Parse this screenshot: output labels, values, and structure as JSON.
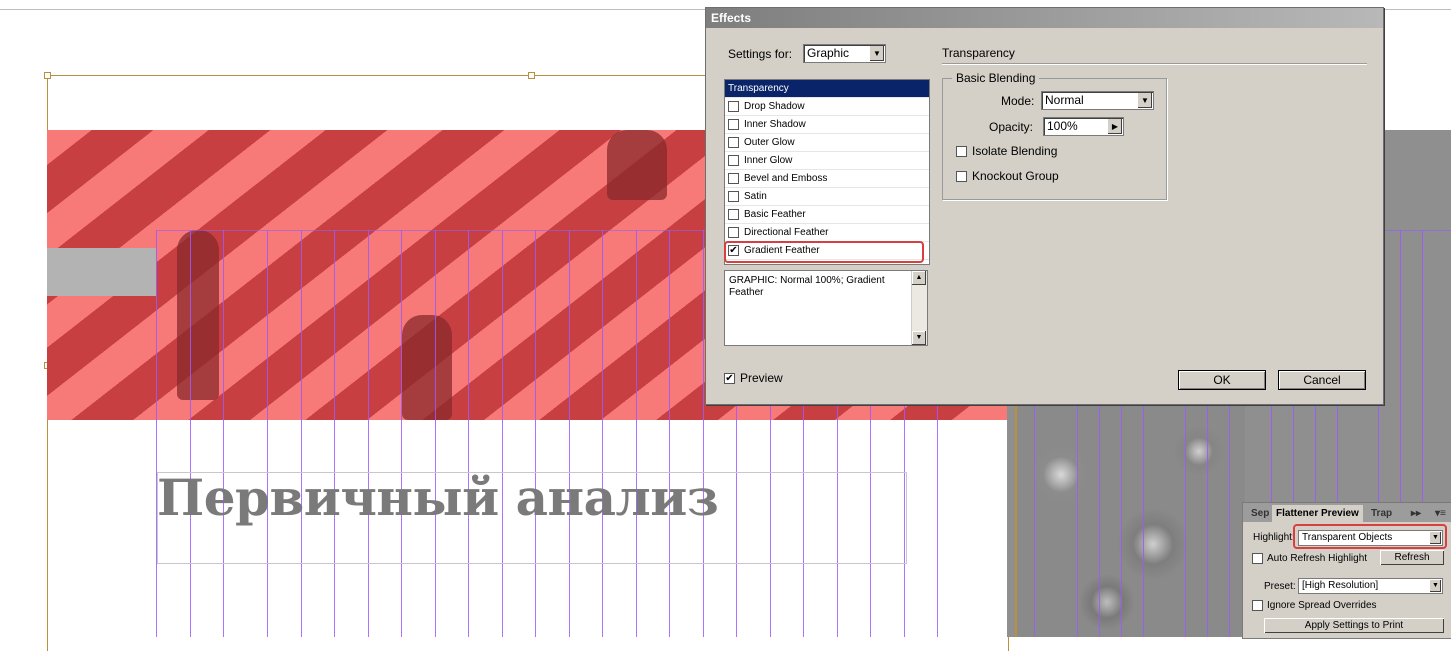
{
  "canvas": {
    "heading": "Первичный анализ"
  },
  "effects_dialog": {
    "title": "Effects",
    "settings_for_label": "Settings for:",
    "settings_for_value": "Graphic",
    "effects": [
      {
        "label": "Transparency",
        "checked": false,
        "selected": true
      },
      {
        "label": "Drop Shadow",
        "checked": false
      },
      {
        "label": "Inner Shadow",
        "checked": false
      },
      {
        "label": "Outer Glow",
        "checked": false
      },
      {
        "label": "Inner Glow",
        "checked": false
      },
      {
        "label": "Bevel and Emboss",
        "checked": false
      },
      {
        "label": "Satin",
        "checked": false
      },
      {
        "label": "Basic Feather",
        "checked": false
      },
      {
        "label": "Directional Feather",
        "checked": false
      },
      {
        "label": "Gradient Feather",
        "checked": true
      }
    ],
    "summary_text": "GRAPHIC: Normal 100%; Gradient Feather",
    "preview_label": "Preview",
    "preview_checked": true,
    "section_title": "Transparency",
    "basic_blending_label": "Basic Blending",
    "mode_label": "Mode:",
    "mode_value": "Normal",
    "opacity_label": "Opacity:",
    "opacity_value": "100%",
    "isolate_blending_label": "Isolate Blending",
    "knockout_group_label": "Knockout Group",
    "ok_label": "OK",
    "cancel_label": "Cancel"
  },
  "flattener_panel": {
    "tabs": [
      "Sep",
      "Flattener Preview",
      "Trap"
    ],
    "highlight_label": "Highlight:",
    "highlight_value": "Transparent Objects",
    "auto_refresh_label": "Auto Refresh Highlight",
    "refresh_label": "Refresh",
    "preset_label": "Preset:",
    "preset_value": "[High Resolution]",
    "ignore_spread_label": "Ignore Spread Overrides",
    "apply_label": "Apply Settings to Print"
  },
  "colors": {
    "highlight_red": "#d64040",
    "selection_blue": "#0a246a",
    "guide_purple": "#9b59ff",
    "photo_light": "#f77a78",
    "photo_dark": "#c73f40"
  }
}
